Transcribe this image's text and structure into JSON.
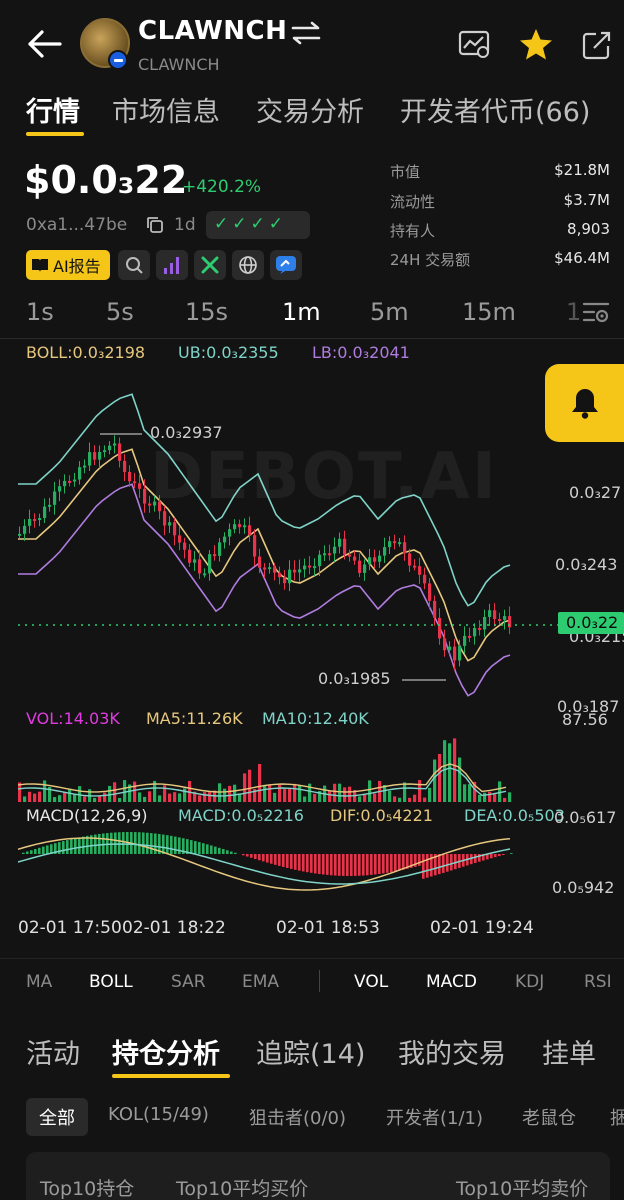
{
  "header": {
    "token_name": "CLAWNCH",
    "token_sub": "CLAWNCH"
  },
  "main_tabs": [
    "行情",
    "市场信息",
    "交易分析",
    "开发者代币(66)"
  ],
  "price": {
    "value": "$0.0₃22",
    "change": "+420.2%",
    "address": "0xa1...47be",
    "age": "1d",
    "checks": "✓✓✓✓"
  },
  "stats": [
    {
      "label": "市值",
      "value": "$21.8M"
    },
    {
      "label": "流动性",
      "value": "$3.7M"
    },
    {
      "label": "持有人",
      "value": "8,903"
    },
    {
      "label": "24H 交易额",
      "value": "$46.4M"
    }
  ],
  "ai_button": "AI报告",
  "timeframes": [
    "1s",
    "5s",
    "15s",
    "1m",
    "5m",
    "15m",
    "1"
  ],
  "active_timeframe": "1m",
  "chart": {
    "boll": "BOLL:0.0₃2198",
    "ub": "UB:0.0₃2355",
    "lb": "LB:0.0₃2041",
    "watermark": "DEBOT.AI",
    "high_label": "0.0₃2937",
    "low_label": "0.0₃1985",
    "y_labels": [
      "0.0₃27",
      "0.0₃243",
      "0.0₃215",
      "0.0₃187"
    ],
    "current_price": "0.0₃22",
    "vol": "VOL:14.03K",
    "ma5": "MA5:11.26K",
    "ma10": "MA10:12.40K",
    "vol_max": "87.56",
    "macd_title": "MACD(12,26,9)",
    "macd": "MACD:0.0₅2216",
    "dif": "DIF:0.0₅4221",
    "dea": "DEA:0.0₅503",
    "macd_top": "0.0₅617",
    "macd_bottom": "0.0₅942",
    "times": [
      "02-01 17:50",
      "02-01 18:22",
      "02-01 18:53",
      "02-01 19:24"
    ]
  },
  "indicators": [
    "MA",
    "BOLL",
    "SAR",
    "EMA",
    "VOL",
    "MACD",
    "KDJ",
    "RSI"
  ],
  "sub_tabs": [
    "活动",
    "持仓分析",
    "追踪(14)",
    "我的交易",
    "挂单"
  ],
  "filters": [
    "全部",
    "KOL(15/49)",
    "狙击者(0/0)",
    "开发者(1/1)",
    "老鼠仓",
    "捆"
  ],
  "table_headers": [
    "Top10持仓",
    "Top10平均买价",
    "Top10平均卖价"
  ],
  "colors": {
    "up": "#27ae60",
    "down": "#e8334a",
    "accent": "#f5c518",
    "boll": "#e6c77e",
    "ub": "#7fd3c8",
    "lb": "#b07ce0",
    "vol": "#e03be0"
  }
}
